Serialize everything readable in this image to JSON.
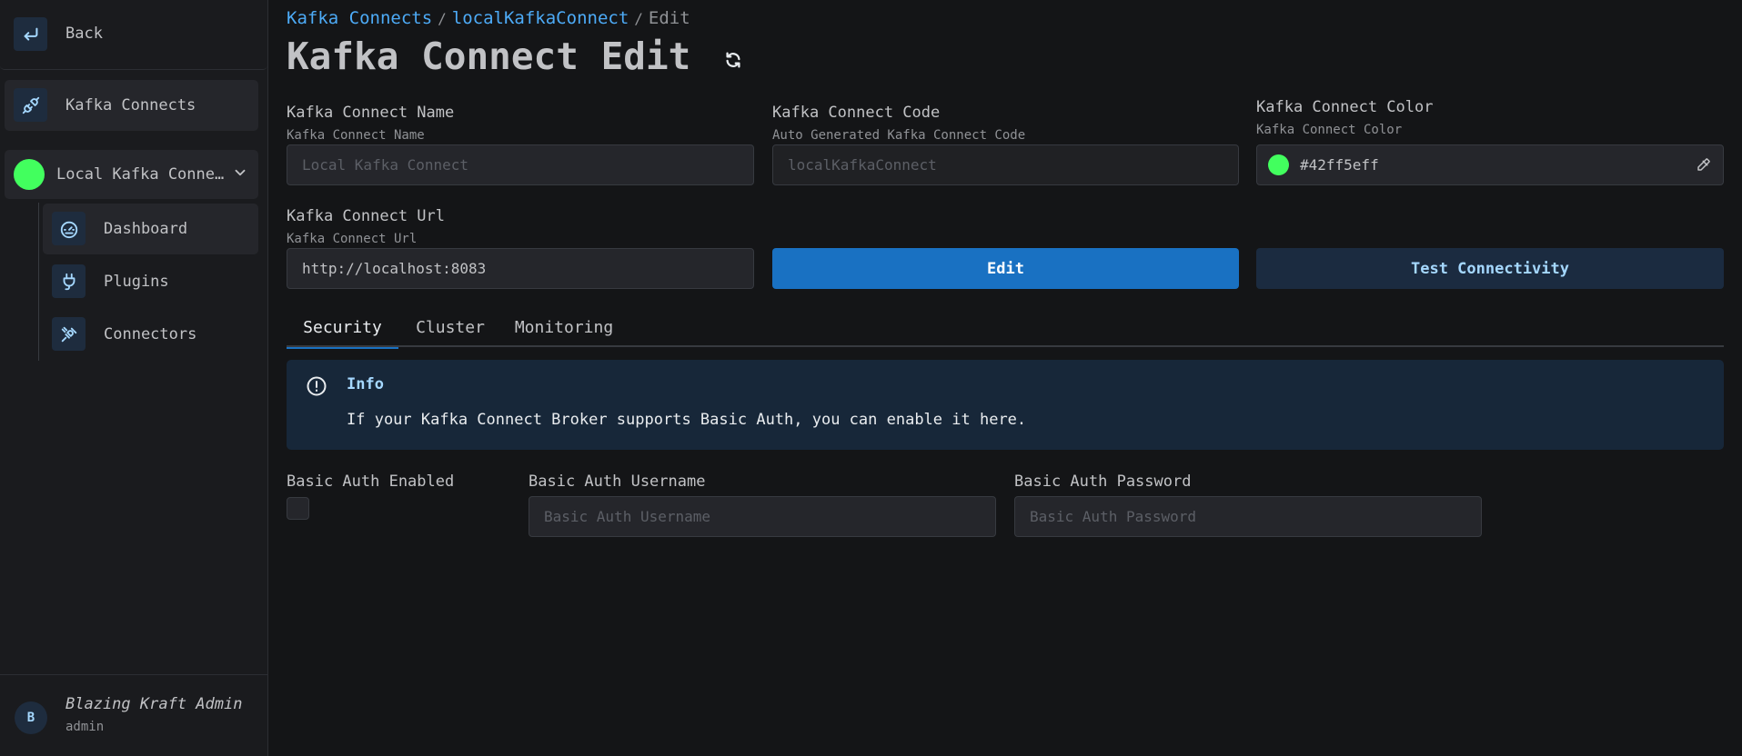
{
  "sidebar": {
    "back_label": "Back",
    "connects_label": "Kafka Connects",
    "group_label": "Local Kafka Conne…",
    "group_color": "#42ff5e",
    "items": [
      {
        "label": "Dashboard",
        "icon": "gauge-icon"
      },
      {
        "label": "Plugins",
        "icon": "plug-icon"
      },
      {
        "label": "Connectors",
        "icon": "connectors-icon"
      }
    ],
    "user": {
      "initial": "B",
      "name": "Blazing Kraft Admin",
      "role": "admin"
    }
  },
  "breadcrumb": {
    "items": [
      "Kafka Connects",
      "localKafkaConnect"
    ],
    "separator": "/",
    "current": "Edit"
  },
  "page": {
    "title": "Kafka Connect Edit"
  },
  "form": {
    "name": {
      "label": "Kafka Connect Name",
      "description": "Kafka Connect Name",
      "placeholder": "Local Kafka Connect"
    },
    "code": {
      "label": "Kafka Connect Code",
      "description": "Auto Generated Kafka Connect Code",
      "placeholder": "localKafkaConnect"
    },
    "color": {
      "label": "Kafka Connect Color",
      "description": "Kafka Connect Color",
      "value": "#42ff5eff"
    },
    "url": {
      "label": "Kafka Connect Url",
      "description": "Kafka Connect Url",
      "value": "http://localhost:8083"
    },
    "edit_button": "Edit",
    "test_button": "Test Connectivity"
  },
  "tabs": [
    "Security",
    "Cluster",
    "Monitoring"
  ],
  "info": {
    "title": "Info",
    "message": "If your Kafka Connect Broker supports Basic Auth, you can enable it here."
  },
  "auth": {
    "enabled_label": "Basic Auth Enabled",
    "username_label": "Basic Auth Username",
    "username_placeholder": "Basic Auth Username",
    "password_label": "Basic Auth Password",
    "password_placeholder": "Basic Auth Password"
  },
  "colors": {
    "accent": "#1971c2",
    "link": "#4dabf7",
    "connect_color": "#42ff5e"
  }
}
